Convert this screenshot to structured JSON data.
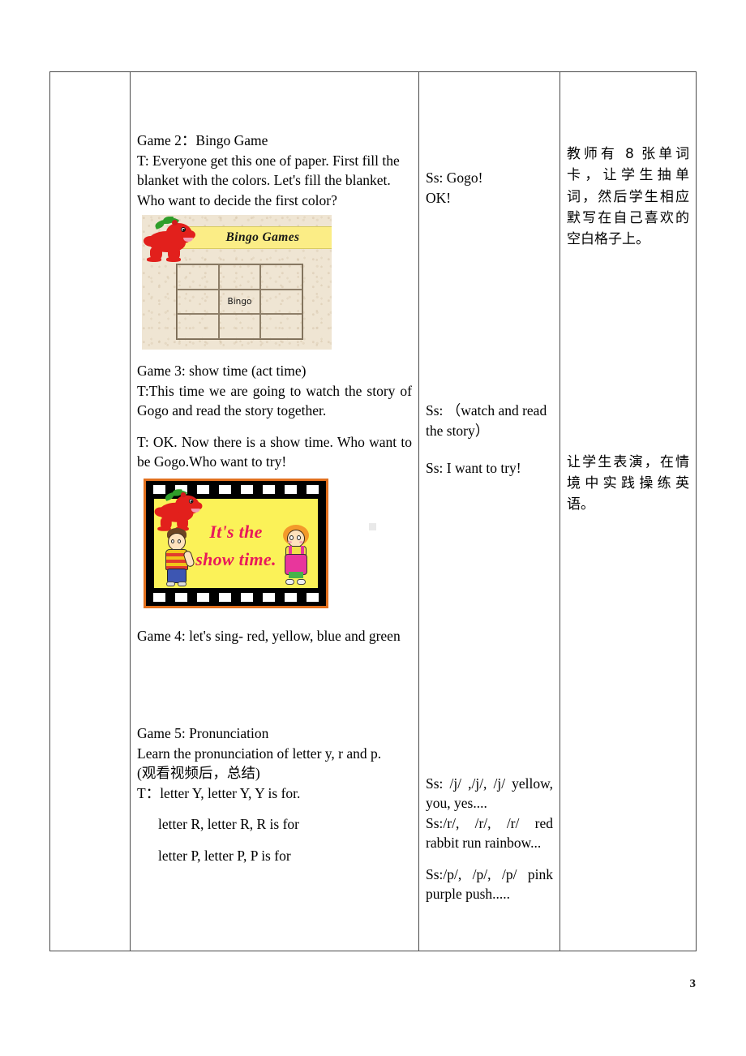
{
  "page": {
    "number": "3"
  },
  "table": {
    "col_a_label": "",
    "rows": [
      {
        "procedure": {
          "game2_title": "Game 2：Bingo Game",
          "game2_body": "T: Everyone get this one of paper. First fill the blanket with the colors. Let's fill the blanket. Who want to decide the first color?",
          "bingo_figure": {
            "banner_title": "Bingo Games",
            "center_cell": "Bingo",
            "grid_rows": 3,
            "grid_cols": 3,
            "bg_color": "#efe5d3",
            "banner_color": "#fbed86",
            "mascot": "red-dragon"
          }
        },
        "students": "Ss: Gogo!\n   OK!",
        "notes": "教师有 8 张单词卡，让学生抽单词，然后学生相应默写在自己喜欢的空白格子上。"
      },
      {
        "procedure": {
          "game3_title": "Game 3: show time (act time)",
          "game3_body1": "T:This time we are going to watch the story of Gogo and read the story together.",
          "game3_body2": "T: OK. Now there is a show time. Who want to be Gogo.Who want to try!",
          "film_figure": {
            "line1": "It's the",
            "line2": "show time.",
            "border_color": "#e2701e",
            "screen_color": "#fbf258",
            "text_color": "#e8195b",
            "characters": [
              "red-dragon",
              "boy",
              "girl"
            ]
          },
          "game4_title": "Game 4: let's sing- red, yellow, blue and green"
        },
        "students_1": "Ss: （watch and read the story）",
        "students_2": "Ss: I want to try!",
        "notes": "让学生表演，在情境中实践操练英语。"
      },
      {
        "procedure": {
          "game5_title": "Game 5: Pronunciation",
          "game5_line1": "Learn the pronunciation of letter y, r and p.",
          "game5_line2": "(观看视频后，总结)",
          "game5_line3": "T：letter Y, letter Y, Y is for.",
          "game5_line4": "letter R, letter R, R is for",
          "game5_line5": "letter P, letter P, P is for"
        },
        "students_y": "Ss: /j/ ,/j/, /j/ yellow, you, yes....",
        "students_r": "Ss:/r/,  /r/,  /r/  red rabbit run rainbow...",
        "students_p": "Ss:/p/,  /p/,  /p/  pink purple push.....",
        "notes": ""
      }
    ]
  }
}
